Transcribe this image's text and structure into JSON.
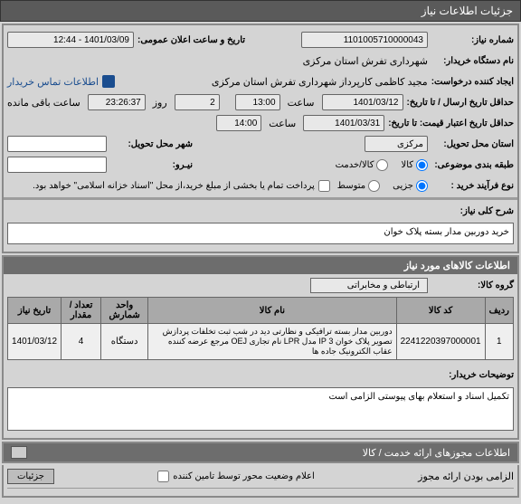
{
  "header": {
    "title": "جزئیات اطلاعات نیاز"
  },
  "form": {
    "need_no_label": "شماره نیاز:",
    "need_no": "1101005710000043",
    "pub_datetime_label": "تاریخ و ساعت اعلان عمومی:",
    "pub_datetime": "1401/03/09 - 12:44",
    "buyer_label": "نام دستگاه خریدار:",
    "buyer": "شهرداری تفرش استان مرکزی",
    "creator_label": "ایجاد کننده درخواست:",
    "creator": "مجید کاظمی کارپرداز شهرداری تفرش استان مرکزی",
    "contact_link": "اطلاعات تماس خریدار",
    "deadline_label": "حداقل تاریخ ارسال / تا تاریخ:",
    "deadline_date": "1401/03/12",
    "deadline_hour_label": "ساعت",
    "deadline_hour": "13:00",
    "qty_label": "روز",
    "qty": "2",
    "minute_label": "ساعت",
    "remain_label": "ساعت باقی مانده",
    "remain": "23:26:37",
    "valid_label": "حداقل تاریخ اعتبار قیمت: تا تاریخ:",
    "valid_date": "1401/03/31",
    "valid_hour_label": "ساعت",
    "valid_hour": "14:00",
    "city_label": "شهر محل تحویل:",
    "city": "مرکزی",
    "province_label": "استان محل تحویل:",
    "ship_label": "نیـرو:",
    "goods_radio": "کالا",
    "service_radio": "کالا/خدمت",
    "class_label": "طبقه بندی موضوعی:",
    "proc_label": "نوع فرآیند خرید :",
    "proc_low": "جزیی",
    "proc_med": "متوسط",
    "pay_note_label": "",
    "pay_note": "پرداخت تمام یا بخشی از مبلغ خرید،از محل \"اسناد خزانه اسلامی\" خواهد بود."
  },
  "need_desc": {
    "label": "شرح کلی نیاز:",
    "text": "خرید دوربین مدار بسته پلاک خوان"
  },
  "goods_section": {
    "title": "اطلاعات کالاهای مورد نیاز",
    "group_label": "گروه کالا:",
    "group_value": "ارتباطی و مخابراتی",
    "headers": {
      "row": "ردیف",
      "code": "کد کالا",
      "name": "نام کالا",
      "unit": "واحد شمارش",
      "qty": "تعداد / مقدار",
      "date": "تاریخ نیاز"
    },
    "rows": [
      {
        "row": "1",
        "code": "2241220397000001",
        "name": "دوربین مدار بسته ترافیکی و نظارتی دید در شب ثبت تخلفات پردازش تصویر پلاک خوان 3 IP مدل LPR نام تجاری OEJ مرجع عرضه کننده عقاب الکترونیک جاده ها",
        "unit": "دستگاه",
        "qty": "4",
        "date": "1401/03/12"
      }
    ]
  },
  "buyer_note": {
    "label": "توضیحات خریدار:",
    "text": "تکمیل اسناد و استعلام بهای پیوستی الزامی است"
  },
  "permits": {
    "title": "اطلاعات مجوزهای ارائه خدمت / کالا"
  },
  "footer": {
    "details_btn": "جزئیات",
    "mid_check_label": "اعلام وضعیت محور توسط تامین کننده",
    "mandatory_label": "الزامی بودن ارائه مجوز"
  }
}
